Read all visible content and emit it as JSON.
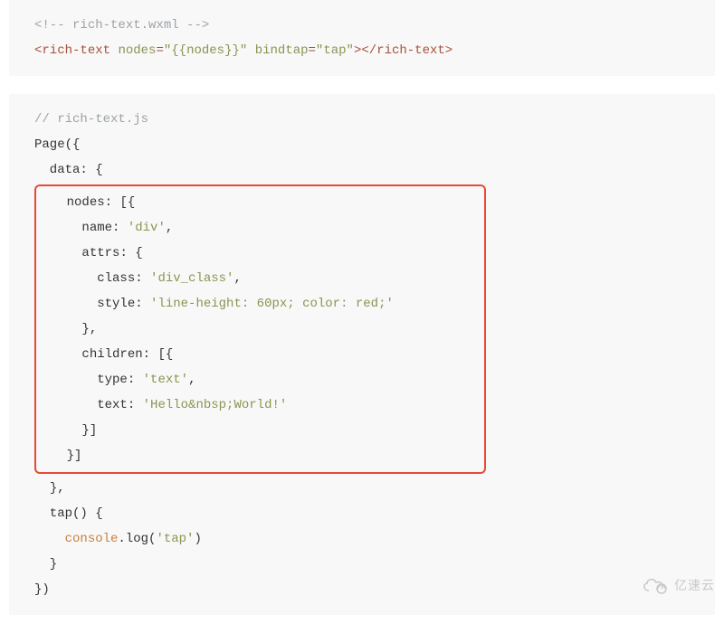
{
  "block1": {
    "comment_open": "<!-- ",
    "comment_text": "rich-text.wxml",
    "comment_close": " -->",
    "tag_open": "<",
    "tag_name": "rich-text",
    "attr_nodes_name": "nodes",
    "eq": "=",
    "q": "\"",
    "attr_nodes_val": "{{nodes}}",
    "attr_bindtap_name": "bindtap",
    "attr_bindtap_val": "tap",
    "tag_gt": ">",
    "tag_close_open": "</",
    "tag_close_gt": ">"
  },
  "block2": {
    "comment": "// rich-text.js",
    "page_fn": "Page",
    "paren_open": "(",
    "brace_open": "{",
    "data_key": "  data",
    "colon": ":",
    "brace_open2": " {",
    "nodes_key": "nodes",
    "arr_open": "[",
    "name_key": "name",
    "name_val": "'div'",
    "comma": ",",
    "attrs_key": "attrs",
    "class_key": "class",
    "class_val": "'div_class'",
    "style_key": "style",
    "style_val": "'line-height: 60px; color: red;'",
    "brace_close": "}",
    "children_key": "children",
    "type_key": "type",
    "type_val": "'text'",
    "text_key": "text",
    "text_val": "'Hello&nbsp;World!'",
    "arr_close": "]",
    "tap_fn": "  tap",
    "paren_pair": "()",
    "console": "console",
    "log": ".log(",
    "tap_str": "'tap'",
    "paren_close": ")",
    "brace_close2": "  }",
    "brace_close3": "}",
    "paren_close2": ")",
    "indent2": "  ",
    "indent4": "    ",
    "indent6": "      ",
    "indent8": "        ",
    "space": " "
  },
  "watermark": {
    "text": "亿速云"
  }
}
